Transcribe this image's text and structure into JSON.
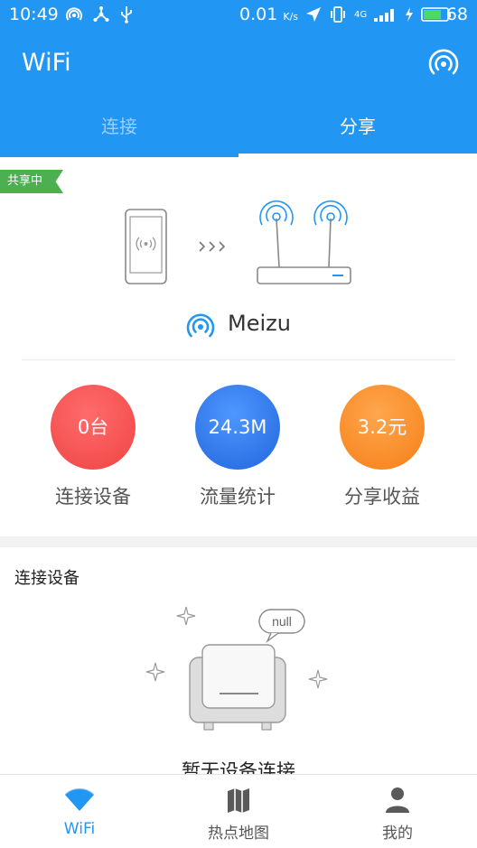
{
  "status_bar": {
    "time": "10:49",
    "speed": "0.01",
    "speed_unit": "K/s",
    "network": "4G",
    "battery": "68"
  },
  "app_bar": {
    "title": "WiFi"
  },
  "tabs": [
    {
      "label": "连接",
      "active": false
    },
    {
      "label": "分享",
      "active": true
    }
  ],
  "share": {
    "badge": "共享中",
    "network_name": "Meizu",
    "stats": [
      {
        "value": "0台",
        "label": "连接设备"
      },
      {
        "value": "24.3M",
        "label": "流量统计"
      },
      {
        "value": "3.2元",
        "label": "分享收益"
      }
    ]
  },
  "devices": {
    "heading": "连接设备",
    "bubble": "null",
    "empty_text": "暂无设备连接"
  },
  "bottom_nav": [
    {
      "label": "WiFi",
      "icon": "wifi-icon",
      "active": true
    },
    {
      "label": "热点地图",
      "icon": "map-icon",
      "active": false
    },
    {
      "label": "我的",
      "icon": "person-icon",
      "active": false
    }
  ],
  "colors": {
    "primary": "#2196f3",
    "badge_green": "#4caf50",
    "devices_red": "#ef4444",
    "traffic_blue": "#2266dd",
    "income_orange": "#f57f17"
  }
}
